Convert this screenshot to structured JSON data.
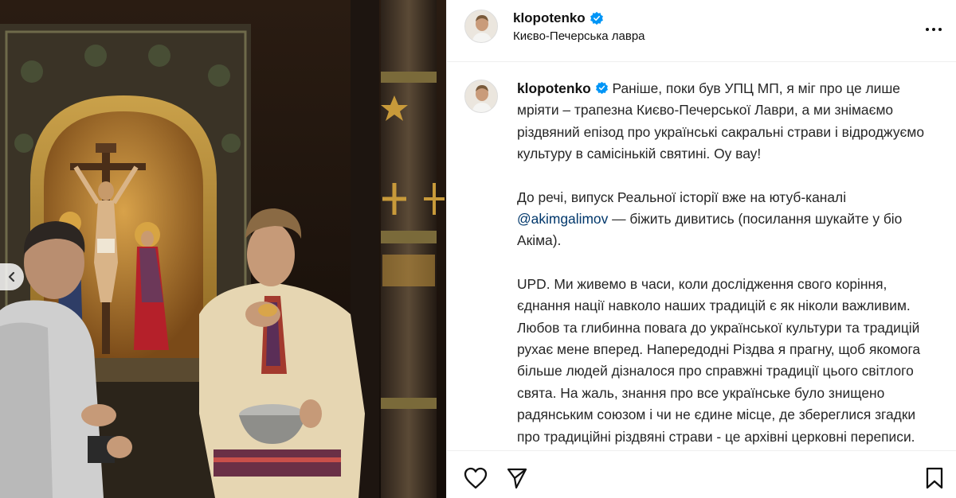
{
  "post": {
    "username": "klopotenko",
    "location": "Києво-Печерська лавра",
    "caption": {
      "line1": "Раніше, поки був УПЦ МП, я міг про це лише мріяти – трапезна Києво-Печерської Лаври, а ми знімаємо різдвяний епізод про українські сакральні страви і відроджуємо культуру в самісінькій святині. Оу вау!",
      "p2_before": "До речі, випуск Реальної історії вже на ютуб-каналі ",
      "p2_mention": "@akimgalimov",
      "p2_after": " — біжить дивитись (посилання шукайте у біо Акіма).",
      "p3": "UPD. Ми живемо в часи, коли дослідження свого коріння, єднання нації навколо наших традицій є як ніколи важливим. Любов та глибинна повага до української культури та традицій рухає мене вперед. Напередодні Різдва я прагну, щоб якомога більше людей дізналося про справжні традиції цього світлого свята. На жаль, знання про все українське було знищено радянським союзом і чи не єдине місце, де збереглися згадки про традиційні різдвяні страви - це архівні церковні переписи. Саме в архівах Києво-Печерської Лаври я знайшов такі страви, як, наприклад, пиріжки з ікрою карася, цибулею та пшоном чи гороховий кисіль, про які розказав у"
    }
  },
  "icons": {
    "verified": "verified-badge-icon",
    "more": "more-options-icon",
    "prev": "chevron-left-icon",
    "like": "heart-icon",
    "share": "paper-plane-icon",
    "save": "bookmark-icon"
  },
  "colors": {
    "verified": "#0095f6",
    "mention": "#00376b",
    "text": "#262626",
    "divider": "#efefef"
  }
}
